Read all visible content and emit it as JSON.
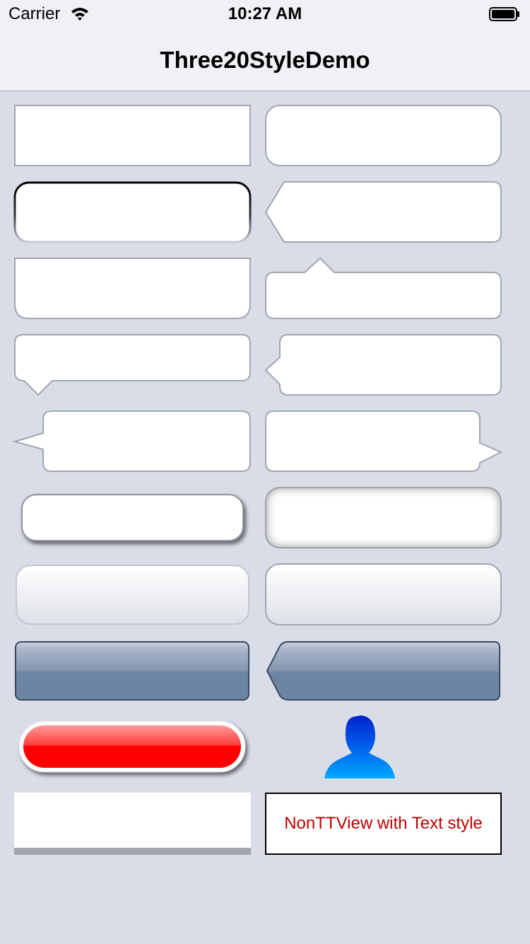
{
  "status_bar": {
    "carrier": "Carrier",
    "time": "10:27 AM",
    "icons": [
      "wifi-icon",
      "battery-icon"
    ]
  },
  "nav_bar": {
    "title": "Three20StyleDemo"
  },
  "styles": {
    "background": "#d9dde8",
    "box_fill": "#ffffff",
    "box_border": "#a1a5af",
    "toolbar_blue": "#6e85a3",
    "red_button": "#ff0000",
    "text_style_color": "#c00000"
  },
  "demo_views": [
    "rect",
    "rounded-rect",
    "dark-top-border-rect",
    "left-arrow-rect",
    "rounded-bottom-rect",
    "top-pointer-speech",
    "bottom-pointer-speech",
    "left-pointer-speech",
    "left-pointer-speech-long",
    "right-pointer-speech",
    "shadow-rounded-rect",
    "inner-shadow-rounded-rect",
    "gradient-rounded-rect",
    "gradient-rounded-rect",
    "blue-toolbar-button",
    "blue-back-button",
    "red-pill-button",
    "person-icon",
    "bottom-border-rect",
    "text-style-view"
  ],
  "text_view": {
    "label": "NonTTView with Text style"
  }
}
